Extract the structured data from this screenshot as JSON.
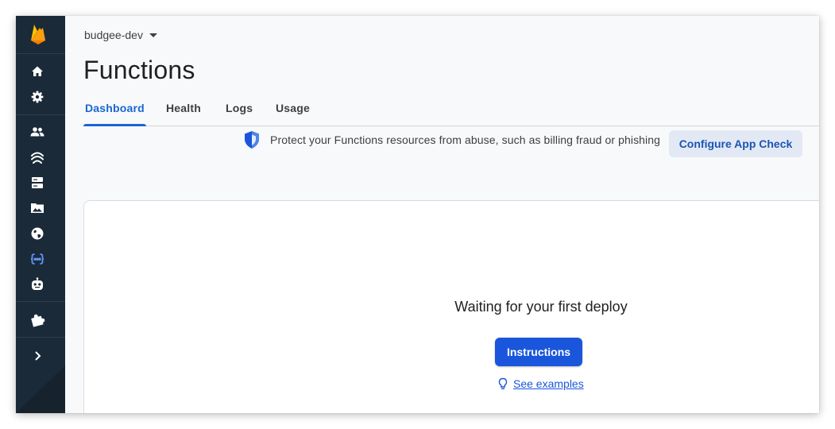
{
  "project": {
    "name": "budgee-dev"
  },
  "page": {
    "title": "Functions"
  },
  "tabs": [
    {
      "label": "Dashboard",
      "active": true
    },
    {
      "label": "Health",
      "active": false
    },
    {
      "label": "Logs",
      "active": false
    },
    {
      "label": "Usage",
      "active": false
    }
  ],
  "notice": {
    "icon": "shield-icon",
    "text": "Protect your Functions resources from abuse, such as billing fraud or phishing",
    "button_label": "Configure App Check"
  },
  "empty_state": {
    "title": "Waiting for your first deploy",
    "button_label": "Instructions",
    "link_icon": "lightbulb-icon",
    "link_text": "See examples"
  },
  "rail": {
    "items": [
      "home-icon",
      "settings-icon",
      "users-icon",
      "realtime-database-icon",
      "firestore-icon",
      "storage-icon",
      "hosting-icon",
      "functions-icon",
      "ml-icon",
      "extensions-icon",
      "expand-icon"
    ],
    "active": "functions-icon"
  },
  "colors": {
    "accent": "#1967d2",
    "primary_button": "#1a56db",
    "secondary_button": "#e3e9f4",
    "rail_background": "#1b2a38"
  }
}
